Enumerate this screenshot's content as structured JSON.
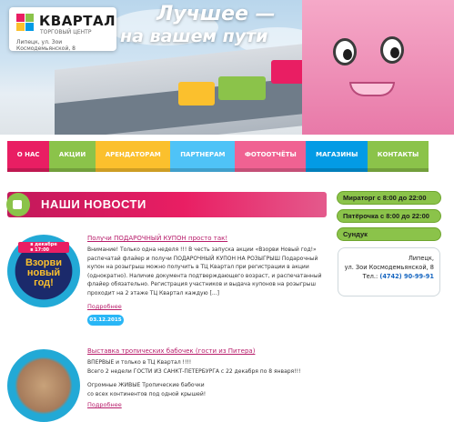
{
  "header": {
    "logo": {
      "name": "КВАРТАЛ",
      "subtitle": "ТОРГОВЫЙ ЦЕНТР",
      "address": "Липецк, ул. Зои Космодемьянской, 8"
    },
    "slogan_line1": "Лучшее —",
    "slogan_line2": "на вашем пути"
  },
  "nav": {
    "items": [
      {
        "label": "О НАС",
        "color": "#e91e63"
      },
      {
        "label": "АКЦИИ",
        "color": "#8bc34a"
      },
      {
        "label": "АРЕНДАТОРАМ",
        "color": "#fbc02d"
      },
      {
        "label": "ПАРТНЕРАМ",
        "color": "#4fc3f7"
      },
      {
        "label": "ФОТООТЧЁТЫ",
        "color": "#f06292"
      },
      {
        "label": "МАГАЗИНЫ",
        "color": "#039be5"
      },
      {
        "label": "КОНТАКТЫ",
        "color": "#8bc34a"
      }
    ]
  },
  "news": {
    "heading": "НАШИ НОВОСТИ",
    "items": [
      {
        "title": "Получи ПОДАРОЧНЫЙ КУПОН просто так!",
        "text": "Внимание! Только одна неделя !!! В честь запуска акции «Взорви Новый год!» распечатай флайер и получи ПОДАРОЧНЫЙ КУПОН НА РОЗЫГРЫШ Подарочный купон на розыгрыш можно получить в ТЦ Квартал при регистрации в акции (однократно). Наличие документа подтверждающего возраст, и распечатанный флайер обязательно. Регистрация участников и выдача купонов на розыгрыш проходит на 2 этаже ТЦ Квартал каждую [...]",
        "more": "Подробнее",
        "date": "03.12.2015",
        "thumb_text_top": "в декабре\nв 17:00",
        "thumb_text": "Взорви\nновый\nгод!"
      },
      {
        "title": "Выставка тропических бабочек (гости из Питера)",
        "text1": "ВПЕРВЫЕ и только в ТЦ Квартал !!!!",
        "text2": "Всего 2 недели ГОСТИ ИЗ САНКТ-ПЕТЕРБУРГА с 22 декабря по 8 января!!!",
        "text3": "Огромные ЖИВЫЕ Тропические бабочки",
        "text4": "со всех континентов под одной крышей!",
        "more": "Подробнее"
      }
    ]
  },
  "sidebar": {
    "hours": [
      {
        "label": "Мираторг с 8:00 до 22:00"
      },
      {
        "label": "Пятёрочка с 8:00 до 22:00"
      },
      {
        "label": "Сундук"
      }
    ],
    "contacts": {
      "line1": "Липецк,",
      "line2": "ул. Зои Космодемьянской, 8",
      "phone_label": "Тел.:",
      "phone": "(4742) 90-99-91"
    }
  },
  "colors": {
    "brand_pink": "#e91e63",
    "brand_green": "#8bc34a",
    "brand_blue": "#039be5",
    "brand_yellow": "#fbc02d"
  }
}
